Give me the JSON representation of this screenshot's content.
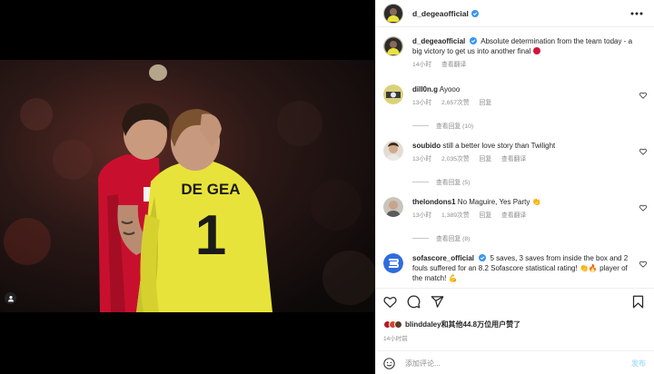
{
  "post": {
    "username": "d_degeaofficial",
    "caption": "Absolute determination from the team today - a big victory to get us into another final",
    "caption_time": "14小时",
    "caption_translate": "查看翻译",
    "photo": {
      "shirt_text": "DE GEA",
      "shirt_number": "1"
    }
  },
  "comments": [
    {
      "username": "dill0n.g",
      "text": "Ayooo",
      "time": "13小时",
      "likes": "2,657次赞",
      "reply": "回复",
      "view_replies": "查看回复 (10)"
    },
    {
      "username": "soubido",
      "text": "still a better love story than Twilight",
      "time": "13小时",
      "likes": "2,035次赞",
      "reply": "回复",
      "translate": "查看翻译",
      "view_replies": "查看回复 (5)"
    },
    {
      "username": "thelondons1",
      "text": "No Maguire, Yes Party 👏",
      "time": "13小时",
      "likes": "1,389次赞",
      "reply": "回复",
      "translate": "查看翻译",
      "view_replies": "查看回复 (8)"
    },
    {
      "username": "sofascore_official",
      "text": "5 saves, 3 saves from inside the box and 2 fouls suffered for an 8.2 Sofascore statistical rating! 👏🔥 player of the match! 💪"
    }
  ],
  "likes": {
    "user": "blinddaley",
    "rest": "和其他44.8万位用户赞了"
  },
  "time": "14小时前",
  "composer": {
    "placeholder": "添加评论...",
    "post": "发布"
  },
  "colors": {
    "verified": "#3897f0",
    "post_button": "#b2dffc",
    "shirt_gk": "#e8e33a",
    "shirt_red": "#c8102e"
  },
  "icons": [
    "instagram-tag-icon",
    "verified-icon",
    "more-icon",
    "heart-icon",
    "comment-icon",
    "share-icon",
    "bookmark-icon",
    "emoji-icon"
  ]
}
